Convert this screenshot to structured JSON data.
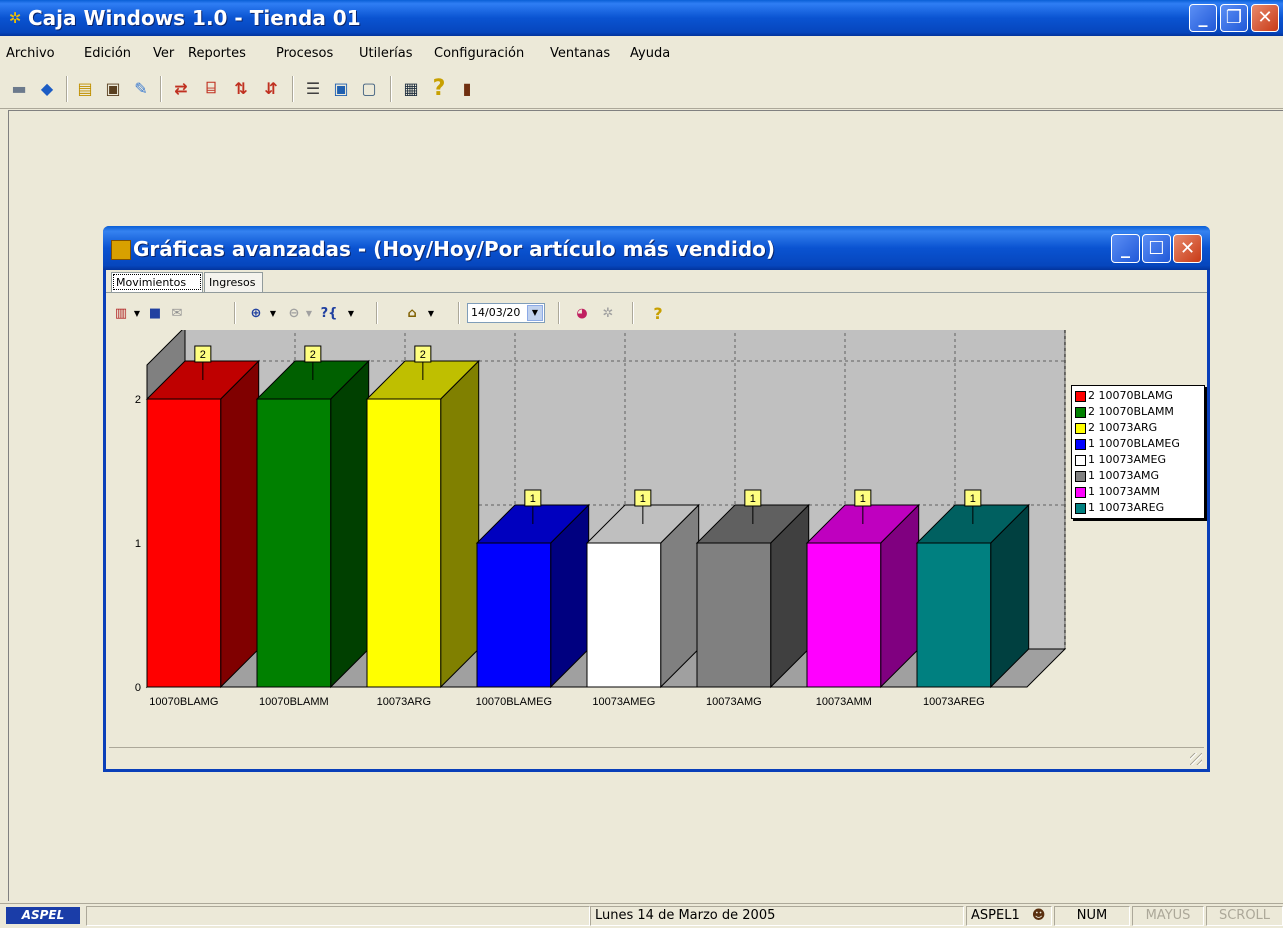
{
  "window": {
    "title": "Caja Windows 1.0 - Tienda 01",
    "minimize": "_",
    "restore": "❐",
    "close": "✕"
  },
  "menu": [
    "Archivo",
    "Edición",
    "Ver",
    "Reportes",
    "Procesos",
    "Utilerías",
    "Configuración",
    "Ventanas",
    "Ayuda"
  ],
  "toolbar_labels": {
    "help": "?",
    "calculator": "▦",
    "exit": "▮"
  },
  "child": {
    "title": "Gráficas avanzadas - (Hoy/Hoy/Por artículo más vendido)",
    "tabs": [
      "Movimientos",
      "Ingresos"
    ],
    "date_value": "14/03/20",
    "date_arrow": "▼",
    "help": "?"
  },
  "chart_data": {
    "type": "bar",
    "categories": [
      "10070BLAMG",
      "10070BLAMM",
      "10073ARG",
      "10070BLAMEG",
      "10073AMEG",
      "10073AMG",
      "10073AMM",
      "10073AREG"
    ],
    "values": [
      2,
      2,
      2,
      1,
      1,
      1,
      1,
      1
    ],
    "data_labels": [
      "2",
      "2",
      "2",
      "1",
      "1",
      "1",
      "1",
      "1"
    ],
    "colors": [
      "#ff0000",
      "#008000",
      "#ffff00",
      "#0000ff",
      "#ffffff",
      "#808080",
      "#ff00ff",
      "#008080"
    ],
    "ylim": [
      0,
      2
    ],
    "yticks": [
      "0",
      "1",
      "2"
    ],
    "legend": [
      "2 10070BLAMG",
      "2 10070BLAMM",
      "2 10073ARG",
      "1 10070BLAMEG",
      "1 10073AMEG",
      "1 10073AMG",
      "1 10073AMM",
      "1 10073AREG"
    ],
    "legend_position": "top-right",
    "style": "3d",
    "grid": true
  },
  "statusbar": {
    "logo": "ASPEL",
    "date": "Lunes 14 de Marzo de 2005",
    "user": "ASPEL1",
    "num": "NUM",
    "mayus": "MAYUS",
    "scroll": "SCROLL"
  }
}
